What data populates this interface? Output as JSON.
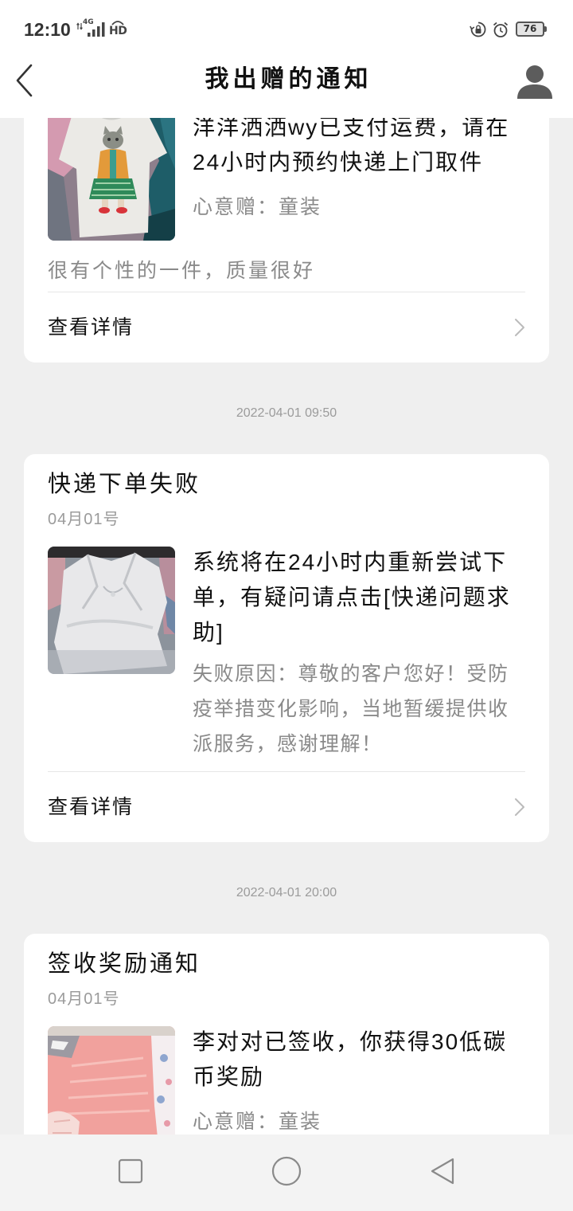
{
  "status_bar": {
    "time": "12:10",
    "network_type": "4G",
    "hd_label": "HD",
    "battery_level": "76",
    "icons": {
      "data_activity": "data-activity-icon",
      "signal": "signal-icon",
      "hd_voice": "hd-voice-icon",
      "rotation_lock": "rotation-lock-icon",
      "alarm": "alarm-icon",
      "battery": "battery-icon"
    }
  },
  "header": {
    "title": "我出赠的通知",
    "back_icon": "chevron-left-icon",
    "profile_icon": "user-avatar-icon"
  },
  "notifications": [
    {
      "message": "洋洋洒洒wy已支付运费，请在24小时内预约快递上门取件",
      "gift_info": "心意赠：童装",
      "description": "很有个性的一件，质量很好",
      "details_label": "查看详情",
      "details_icon": "chevron-right-icon"
    },
    {
      "timestamp": "2022-04-01 09:50",
      "title": "快递下单失败",
      "date": "04月01号",
      "message": "系统将在24小时内重新尝试下单，有疑问请点击[快递问题求助]",
      "failure_reason": "失败原因：尊敬的客户您好！受防疫举措变化影响，当地暂缓提供收派服务，感谢理解！",
      "details_label": "查看详情",
      "details_icon": "chevron-right-icon"
    },
    {
      "timestamp": "2022-04-01 20:00",
      "title": "签收奖励通知",
      "date": "04月01号",
      "message": "李对对已签收，你获得30低碳币奖励",
      "gift_info": "心意赠：童装"
    }
  ],
  "nav_bar": {
    "recent_icon": "recent-apps-icon",
    "home_icon": "home-icon",
    "back_icon": "back-triangle-icon"
  },
  "colors": {
    "page_background": "#efefef",
    "bar_background": "#ffffff",
    "card_background": "#ffffff",
    "text_primary": "#111111",
    "text_secondary": "#8a8a8a",
    "text_timestamp": "#9b9b9b",
    "divider": "#e6e6e6",
    "chevron": "#bbbbbb",
    "nav_background": "#f3f3f3",
    "nav_icon": "#8a8a8a"
  }
}
